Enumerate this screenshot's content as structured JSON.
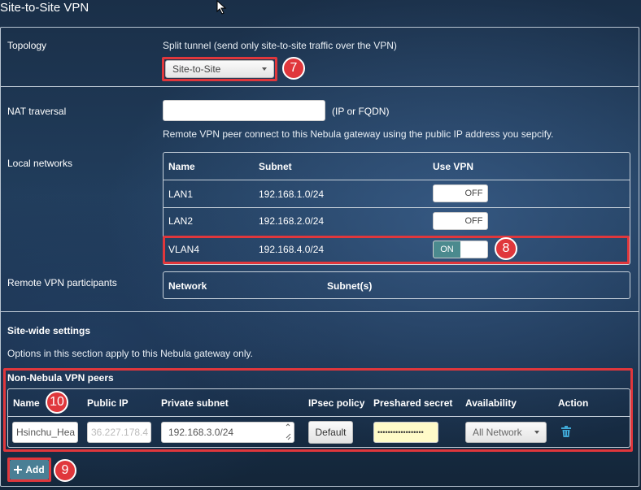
{
  "page": {
    "title": "Site-to-Site VPN"
  },
  "topology": {
    "label": "Topology",
    "hint": "Split tunnel (send only site-to-site traffic over the VPN)",
    "selected": "Site-to-Site",
    "callout": "7"
  },
  "nat": {
    "label": "NAT traversal",
    "value": "",
    "suffix": "(IP or FQDN)",
    "help": "Remote VPN peer connect to this Nebula gateway using the public IP address you sepcify."
  },
  "local_networks": {
    "label": "Local networks",
    "columns": [
      "Name",
      "Subnet",
      "Use VPN"
    ],
    "rows": [
      {
        "name": "LAN1",
        "subnet": "192.168.1.0/24",
        "vpn": "OFF"
      },
      {
        "name": "LAN2",
        "subnet": "192.168.2.0/24",
        "vpn": "OFF"
      },
      {
        "name": "VLAN4",
        "subnet": "192.168.4.0/24",
        "vpn": "ON"
      }
    ],
    "callout": "8"
  },
  "remote_vpn": {
    "label": "Remote VPN participants",
    "columns": [
      "Network",
      "Subnet(s)"
    ]
  },
  "site_wide": {
    "title": "Site-wide settings",
    "description": "Options in this section apply to this Nebula gateway only."
  },
  "peers": {
    "title": "Non-Nebula VPN peers",
    "columns": [
      "Name",
      "Public IP",
      "Private subnet",
      "IPsec policy",
      "Preshared secret",
      "Availability",
      "Action"
    ],
    "name_callout": "10",
    "row": {
      "name": "Hsinchu_Hea",
      "public_ip": "36.227.178.4",
      "private_subnet": "192.168.3.0/24",
      "ipsec_policy": "Default",
      "preshared_secret": "••••••••••••••••••",
      "availability": "All Network"
    },
    "action_icon": "trash-icon"
  },
  "add": {
    "label": "Add",
    "callout": "9"
  }
}
